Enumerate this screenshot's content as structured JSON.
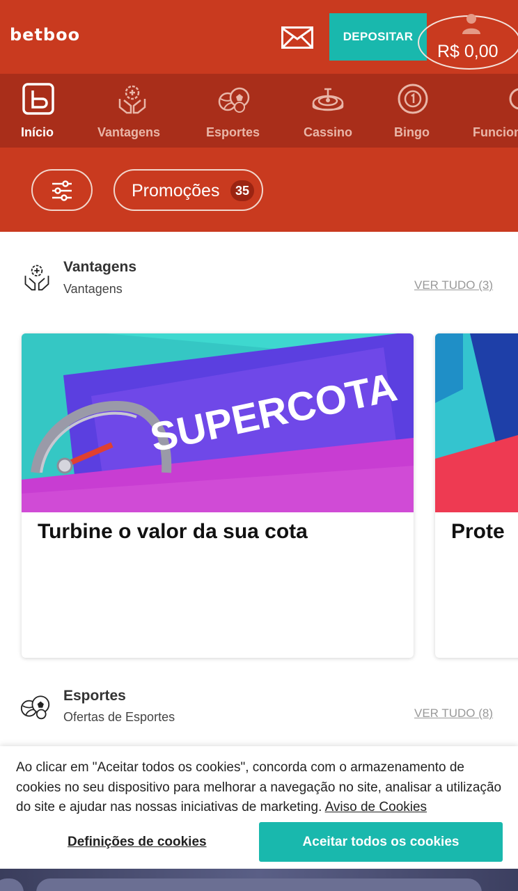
{
  "header": {
    "logo": "betboo",
    "mail_icon": "mail-icon",
    "deposit_label": "DEPOSITAR",
    "user_icon": "user-icon",
    "balance": "R$ 0,00"
  },
  "nav": {
    "items": [
      {
        "label": "Início",
        "icon": "home-b-icon",
        "active": true
      },
      {
        "label": "Vantagens",
        "icon": "hands-gear-icon"
      },
      {
        "label": "Esportes",
        "icon": "sports-balls-icon"
      },
      {
        "label": "Cassino",
        "icon": "roulette-icon"
      },
      {
        "label": "Bingo",
        "icon": "bingo-ball-icon"
      },
      {
        "label": "Funcion",
        "icon": "features-icon"
      }
    ]
  },
  "filters": {
    "filter_icon": "sliders-icon",
    "promo_label": "Promoções",
    "promo_count": "35"
  },
  "sections": [
    {
      "title": "Vantagens",
      "subtitle": "Vantagens",
      "see_all": "VER TUDO (3)",
      "icon": "hands-gear-icon"
    },
    {
      "title": "Esportes",
      "subtitle": "Ofertas de Esportes",
      "see_all": "VER TUDO (8)",
      "icon": "sports-balls-icon"
    }
  ],
  "cards": [
    {
      "image_text": "SUPERCOTA",
      "title": "Turbine o valor da sua cota"
    },
    {
      "title": "Prote"
    }
  ],
  "cookie": {
    "text": "Ao clicar em \"Aceitar todos os cookies\", concorda com o armazenamento de cookies no seu dispositivo para melhorar a navegação no site, analisar a utilização do site e ajudar nas nossas iniciativas de marketing.",
    "link": "Aviso de Cookies",
    "settings_label": "Definições de cookies",
    "accept_label": "Aceitar todos os cookies"
  },
  "colors": {
    "brand": "#c93a1f",
    "nav_bg": "#a92e1a",
    "accent": "#19b8ad"
  }
}
